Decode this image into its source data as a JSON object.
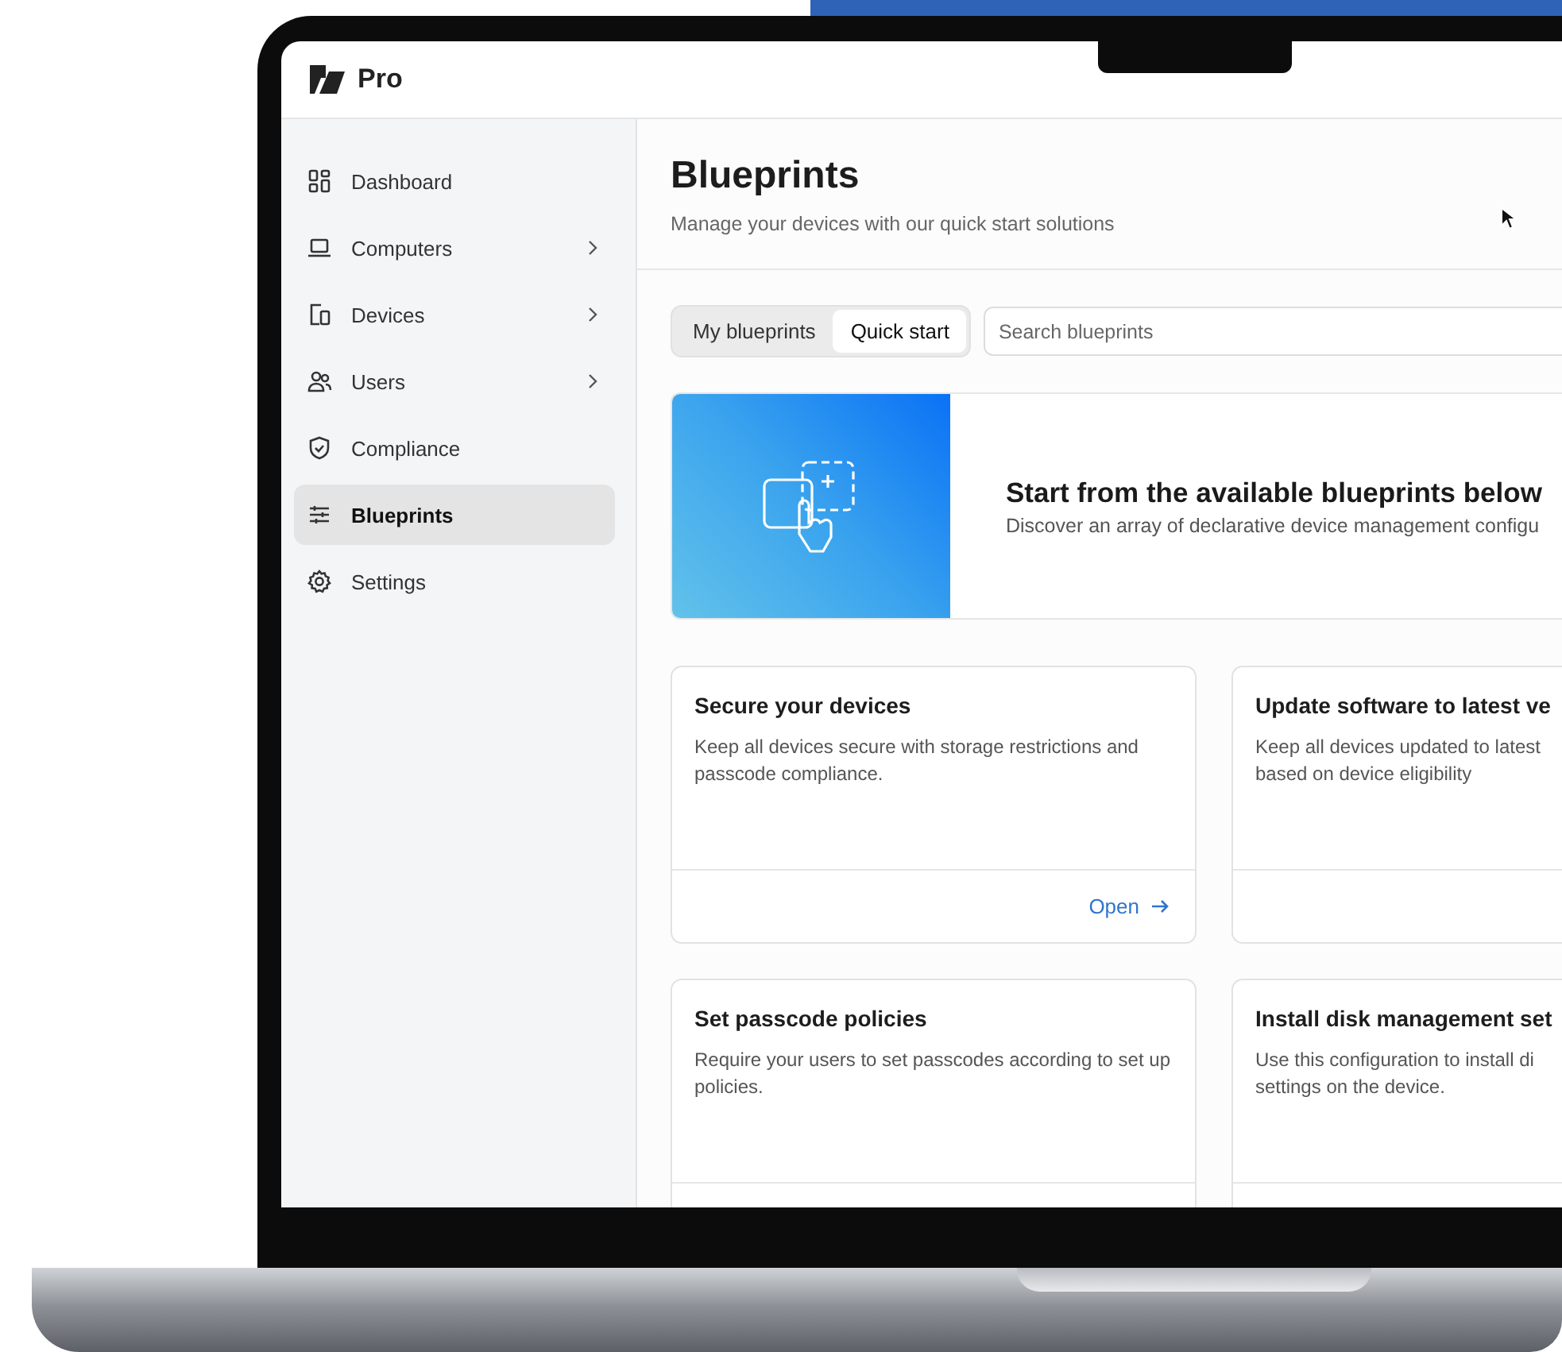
{
  "app": {
    "logo_text": "Pro"
  },
  "sidebar": {
    "items": [
      {
        "label": "Dashboard",
        "expandable": false,
        "selected": false
      },
      {
        "label": "Computers",
        "expandable": true,
        "selected": false
      },
      {
        "label": "Devices",
        "expandable": true,
        "selected": false
      },
      {
        "label": "Users",
        "expandable": true,
        "selected": false
      },
      {
        "label": "Compliance",
        "expandable": false,
        "selected": false
      },
      {
        "label": "Blueprints",
        "expandable": false,
        "selected": true
      },
      {
        "label": "Settings",
        "expandable": false,
        "selected": false
      }
    ]
  },
  "page": {
    "title": "Blueprints",
    "subtitle": "Manage your devices with our quick start solutions"
  },
  "tabs": [
    {
      "label": "My blueprints",
      "selected": false
    },
    {
      "label": "Quick start",
      "selected": true
    }
  ],
  "search": {
    "placeholder": "Search blueprints"
  },
  "banner": {
    "title": "Start from the available blueprints below",
    "text": "Discover an array of declarative device management configu"
  },
  "cards": [
    {
      "title": "Secure your devices",
      "description": "Keep all devices secure with storage restrictions and passcode compliance.",
      "action": "Open"
    },
    {
      "title": "Update software to latest ve",
      "description": "Keep all devices updated to latest based on device eligibility"
    },
    {
      "title": "Set passcode policies",
      "description": "Require your users to set passcodes according to set up policies."
    },
    {
      "title": "Install disk management set",
      "description": "Use this configuration to install di settings on the device."
    }
  ]
}
